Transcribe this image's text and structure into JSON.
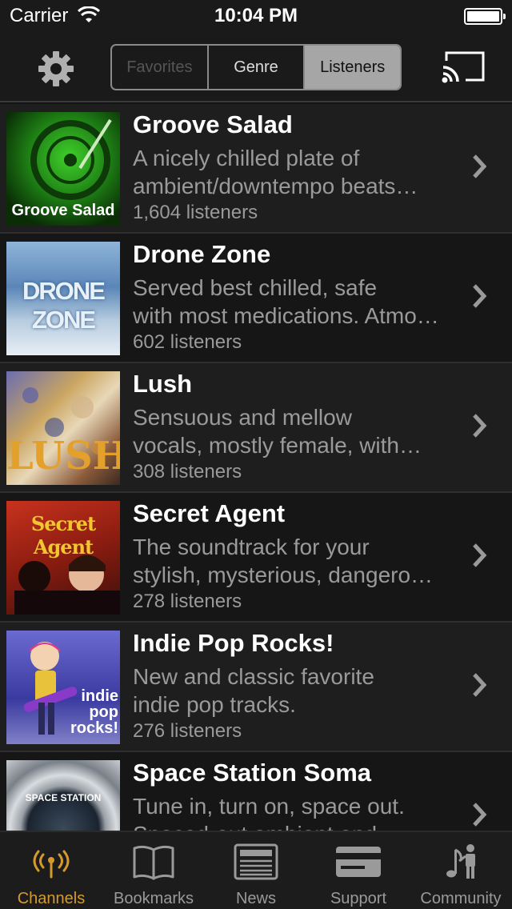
{
  "status": {
    "carrier": "Carrier",
    "time": "10:04 PM"
  },
  "segments": [
    "Favorites",
    "Genre",
    "Listeners"
  ],
  "colors": {
    "accent": "#d69a2c",
    "segment_active": "#a6a6a6"
  },
  "channels": [
    {
      "title": "Groove Salad",
      "desc1": "A nicely chilled plate of",
      "desc2": "ambient/downtempo beats…",
      "listeners": "1,604 listeners",
      "art_text": "Groove Salad"
    },
    {
      "title": "Drone Zone",
      "desc1": "Served best chilled, safe",
      "desc2": "with most medications. Atmo…",
      "listeners": "602 listeners",
      "art_text": "DRONE ZONE"
    },
    {
      "title": "Lush",
      "desc1": "Sensuous and mellow",
      "desc2": "vocals, mostly female, with…",
      "listeners": "308 listeners",
      "art_text": "LUSH"
    },
    {
      "title": "Secret Agent",
      "desc1": "The soundtrack for your",
      "desc2": "stylish, mysterious, dangerous…",
      "listeners": "278 listeners",
      "art_text": "Secret Agent"
    },
    {
      "title": "Indie Pop Rocks!",
      "desc1": "New and classic favorite",
      "desc2": "indie pop tracks.",
      "listeners": "276 listeners",
      "art_text": "indie pop rocks!"
    },
    {
      "title": "Space Station Soma",
      "desc1": "Tune in, turn on, space out.",
      "desc2": "Spaced-out ambient and",
      "listeners": "",
      "art_text": "SPACE STATION"
    }
  ],
  "tabs": [
    {
      "label": "Channels",
      "icon": "broadcast-icon"
    },
    {
      "label": "Bookmarks",
      "icon": "book-icon"
    },
    {
      "label": "News",
      "icon": "newspaper-icon"
    },
    {
      "label": "Support",
      "icon": "credit-card-icon"
    },
    {
      "label": "Community",
      "icon": "community-icon"
    }
  ]
}
